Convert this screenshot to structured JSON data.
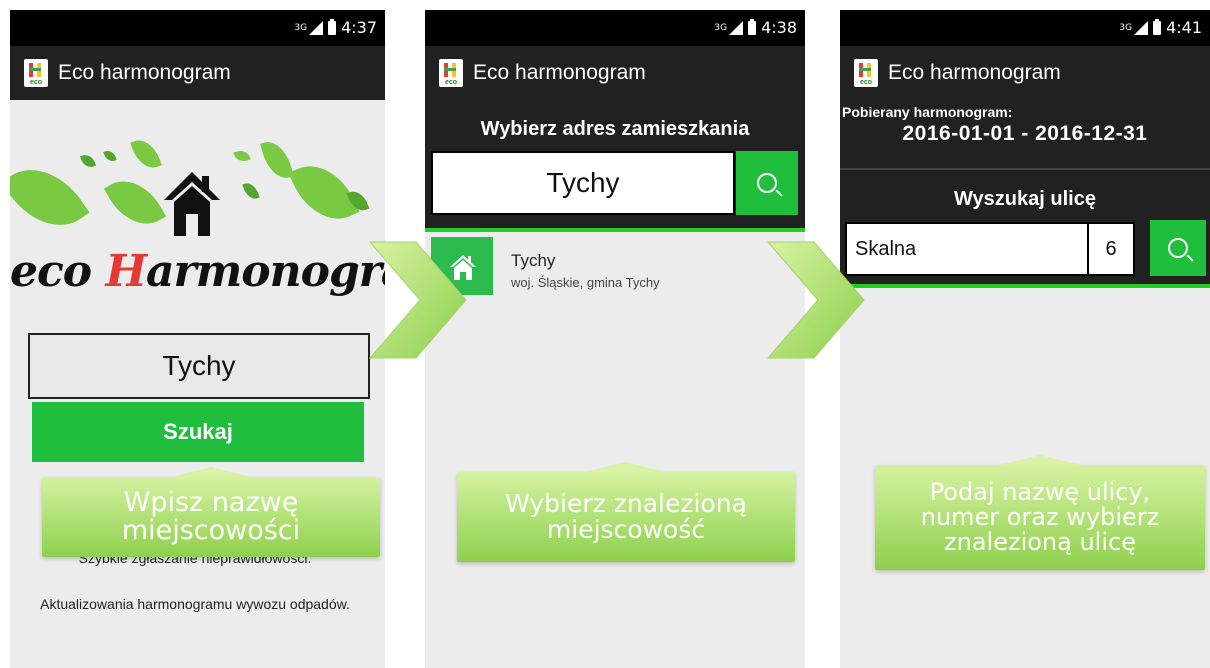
{
  "app": {
    "title": "Eco harmonogram",
    "icon": "eco-app-icon"
  },
  "phones": [
    {
      "time": "4:37",
      "network": "3G"
    },
    {
      "time": "4:38",
      "network": "3G"
    },
    {
      "time": "4:41",
      "network": "3G"
    }
  ],
  "screen1": {
    "logo_prefix": "eco ",
    "logo_h": "H",
    "logo_rest": "armonogram",
    "city_value": "Tychy",
    "search_button": "Szukaj",
    "info_lines": [
      "Szybkie zgłaszanie nieprawidłowości.",
      "Aktualizowania harmonogramu wywozu odpadów."
    ]
  },
  "screen2": {
    "header": "Wybierz adres zamieszkania",
    "search_value": "Tychy",
    "result_name": "Tychy",
    "result_sub": "woj. Śląskie, gmina Tychy"
  },
  "screen3": {
    "schedule_label": "Pobierany harmonogram:",
    "date_range": "2016-01-01 - 2016-12-31",
    "header": "Wyszukaj ulicę",
    "street_value": "Skalna",
    "number_value": "6"
  },
  "callouts": [
    "Wpisz nazwę\nmiejscowości",
    "Wybierz znalezioną\nmiejscowość",
    "Podaj nazwę ulicy,\nnumer oraz wybierz\nznalezioną ulicę"
  ],
  "colors": {
    "accent_green": "#1fbf3d",
    "bar_dark": "#212121",
    "callout_green": "#8ed04d"
  }
}
